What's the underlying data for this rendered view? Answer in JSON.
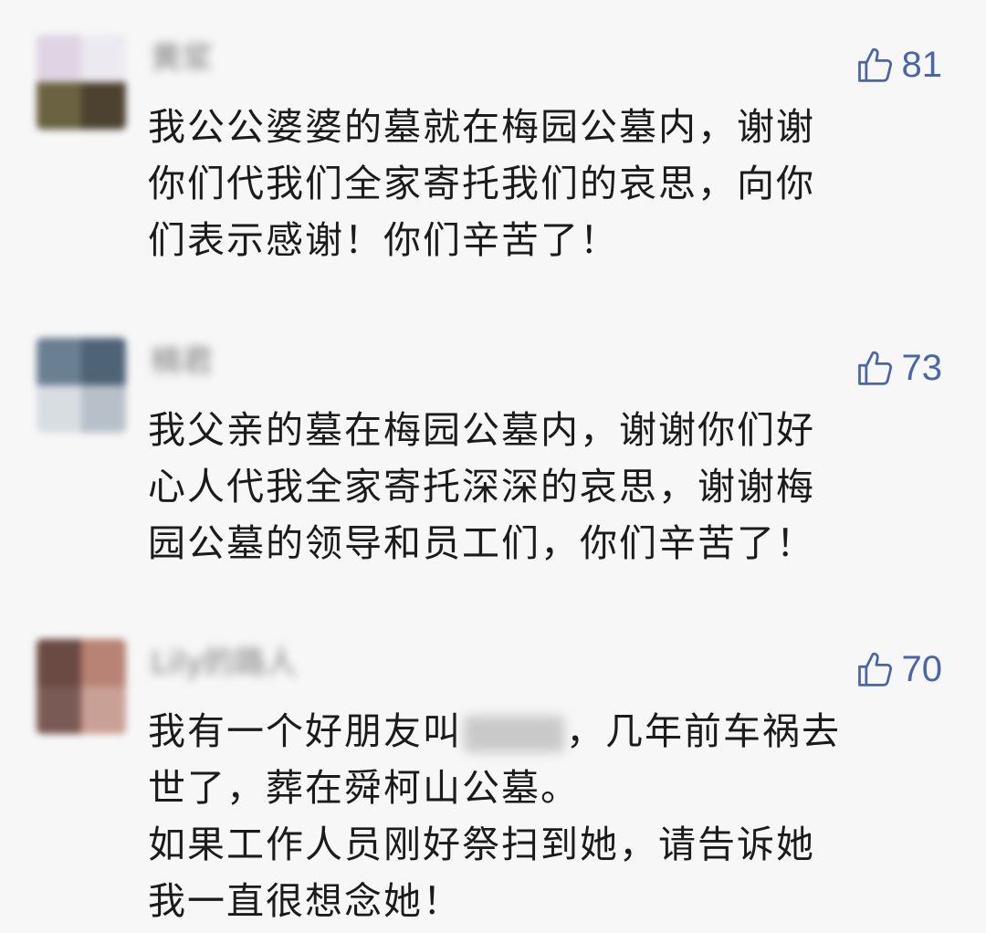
{
  "comments": [
    {
      "username": "黄浆",
      "likes": "81",
      "avatar_colors": [
        "#dfd4e4",
        "#eceaf0",
        "#6a6241",
        "#4d4230"
      ],
      "lines": [
        "我公公婆婆的墓就在梅园公墓内，谢谢",
        "你们代我们全家寄托我们的哀思，向你",
        "们表示感谢！你们辛苦了！"
      ]
    },
    {
      "username": "楠君",
      "likes": "73",
      "avatar_colors": [
        "#6b7f92",
        "#4f6377",
        "#d8dde2",
        "#b7c0c8"
      ],
      "lines": [
        "我父亲的墓在梅园公墓内，谢谢你们好",
        "心人代我全家寄托深深的哀思，谢谢梅",
        "园公墓的领导和员工们，你们辛苦了！"
      ]
    },
    {
      "username": "Lily的路人",
      "likes": "70",
      "avatar_colors": [
        "#6b4a44",
        "#b88374",
        "#7a5a55",
        "#c9a096"
      ],
      "line0_before": "我有一个好朋友叫",
      "line0_after": "，几年前车祸去",
      "lines": [
        "",
        "世了，葬在舜柯山公墓。",
        "如果工作人员刚好祭扫到她，请告诉她",
        "我一直很想念她！"
      ]
    }
  ],
  "colors": {
    "background": "#f7f7f7",
    "text": "#1b1b1b",
    "like_accent": "#4a66a8",
    "username": "#7d7d7d"
  },
  "icons": {
    "like": "thumbs-up-icon"
  }
}
